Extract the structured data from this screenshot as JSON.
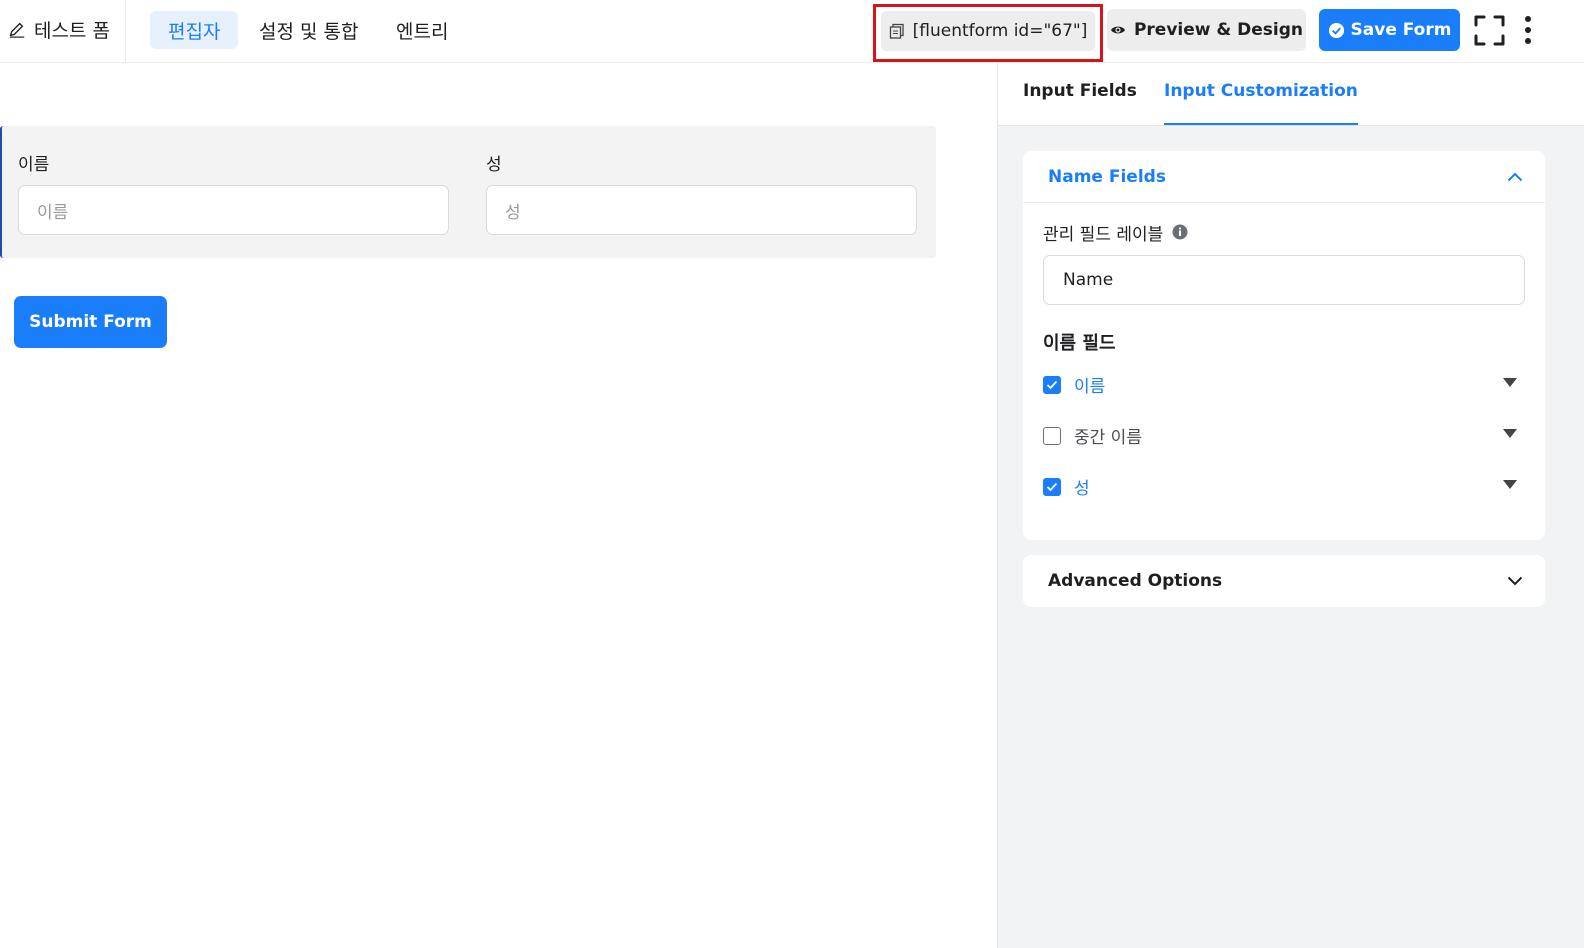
{
  "header": {
    "form_title": "테스트 폼",
    "tabs": [
      {
        "label": "편집자"
      },
      {
        "label": "설정 및 통합"
      },
      {
        "label": "엔트리"
      }
    ],
    "shortcode": "[fluentform id=\"67\"]",
    "preview_label": "Preview & Design",
    "save_label": "Save Form"
  },
  "form": {
    "fields": [
      {
        "label": "이름",
        "placeholder": "이름"
      },
      {
        "label": "성",
        "placeholder": "성"
      }
    ],
    "submit_label": "Submit Form"
  },
  "panel": {
    "tabs": [
      {
        "label": "Input Fields"
      },
      {
        "label": "Input Customization"
      }
    ],
    "name_fields_card": {
      "title": "Name Fields",
      "admin_label_title": "관리 필드 레이블",
      "admin_label_value": "Name",
      "section_title": "이름 필드",
      "items": [
        {
          "label": "이름",
          "checked": true
        },
        {
          "label": "중간 이름",
          "checked": false
        },
        {
          "label": "성",
          "checked": true
        }
      ]
    },
    "advanced_card": {
      "title": "Advanced Options"
    }
  },
  "colors": {
    "accent": "#1a7efb",
    "highlight_border": "#d9121f",
    "panel_bg": "#f2f3f5"
  }
}
